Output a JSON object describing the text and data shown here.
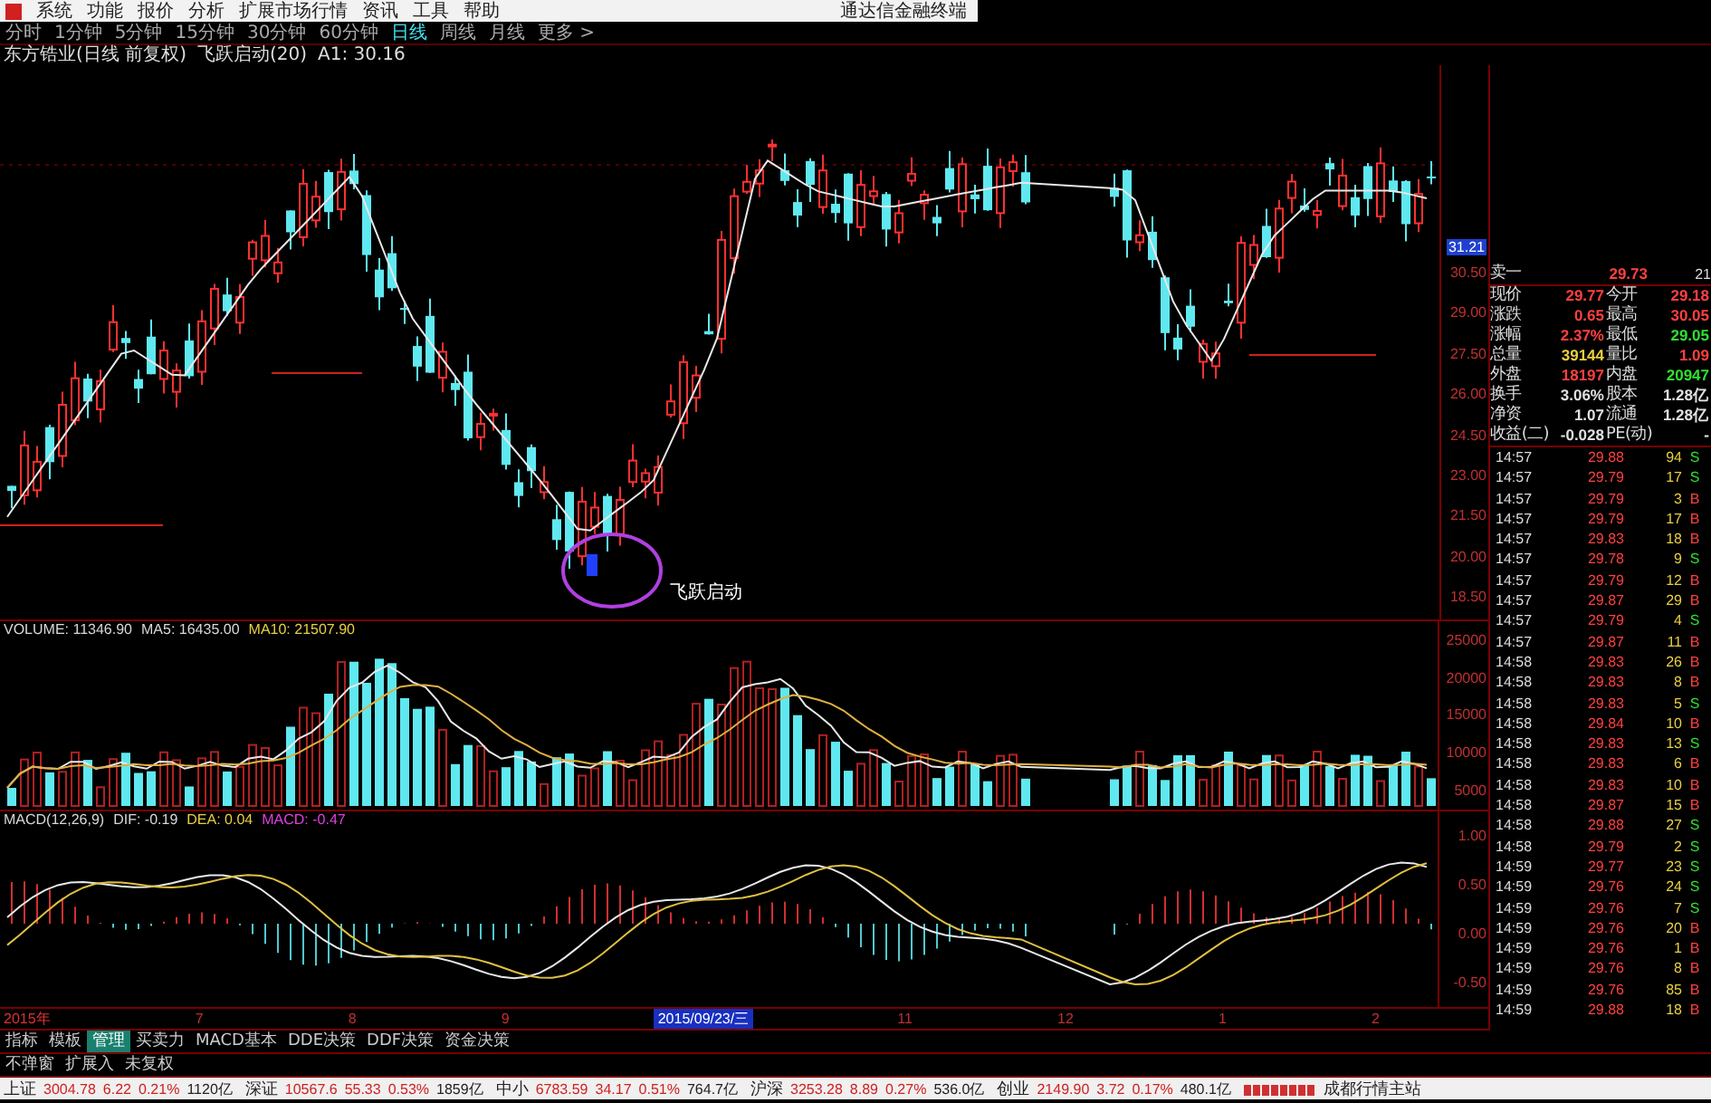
{
  "menu": {
    "items": [
      "系统",
      "功能",
      "报价",
      "分析",
      "扩展市场行情",
      "资讯",
      "工具",
      "帮助"
    ],
    "app_title": "通达信金融终端"
  },
  "periods": [
    {
      "label": "分时",
      "selected": false
    },
    {
      "label": "1分钟",
      "selected": false
    },
    {
      "label": "5分钟",
      "selected": false
    },
    {
      "label": "15分钟",
      "selected": false
    },
    {
      "label": "30分钟",
      "selected": false
    },
    {
      "label": "60分钟",
      "selected": false
    },
    {
      "label": "日线",
      "selected": true
    },
    {
      "label": "周线",
      "selected": false
    },
    {
      "label": "月线",
      "selected": false
    },
    {
      "label": "更多 >",
      "selected": false
    }
  ],
  "main_chart": {
    "title": "东方锆业(日线 前复权)",
    "indicator": "飞跃启动(20)",
    "readout": "A1: 30.16",
    "annotation": "飞跃启动",
    "cursor_label": "31.21",
    "axis_labels": [
      "30.50",
      "29.00",
      "27.50",
      "26.00",
      "24.50",
      "23.00",
      "21.50",
      "20.00",
      "18.50"
    ]
  },
  "volume": {
    "readouts": [
      {
        "text": "VOLUME: 11346.90",
        "color": "#d8d8d8"
      },
      {
        "text": "MA5: 16435.00",
        "color": "#d8d8d8"
      },
      {
        "text": "MA10: 21507.90",
        "color": "#e8d040"
      }
    ],
    "axis_labels": [
      "25000",
      "20000",
      "15000",
      "10000",
      "5000"
    ]
  },
  "macd": {
    "readouts": [
      {
        "text": "MACD(12,26,9)",
        "color": "#d8d8d8"
      },
      {
        "text": "DIF: -0.19",
        "color": "#d8d8d8"
      },
      {
        "text": "DEA: 0.04",
        "color": "#e8d040"
      },
      {
        "text": "MACD: -0.47",
        "color": "#e040e0"
      }
    ],
    "axis_labels": [
      "1.00",
      "0.50",
      "0.00",
      "-0.50"
    ]
  },
  "date_axis": [
    {
      "label": "2015年",
      "kind": "year"
    },
    {
      "label": "7",
      "kind": "month"
    },
    {
      "label": "8",
      "kind": "month"
    },
    {
      "label": "9",
      "kind": "month"
    },
    {
      "label": "2015/09/23/三",
      "kind": "cursor"
    },
    {
      "label": "11",
      "kind": "month"
    },
    {
      "label": "12",
      "kind": "month"
    },
    {
      "label": "1",
      "kind": "month"
    },
    {
      "label": "2",
      "kind": "month"
    }
  ],
  "quote": {
    "header": {
      "label": "卖一",
      "price": "29.73",
      "volume": "21"
    },
    "fields": [
      {
        "label": "现价",
        "value": "29.77",
        "color": "#ff4040"
      },
      {
        "label": "今开",
        "value": "29.18",
        "color": "#ff4040"
      },
      {
        "label": "涨跌",
        "value": "0.65",
        "color": "#ff4040"
      },
      {
        "label": "最高",
        "value": "30.05",
        "color": "#ff4040"
      },
      {
        "label": "涨幅",
        "value": "2.37%",
        "color": "#ff4040"
      },
      {
        "label": "最低",
        "value": "29.05",
        "color": "#30e030"
      },
      {
        "label": "总量",
        "value": "39144",
        "color": "#e8d040"
      },
      {
        "label": "量比",
        "value": "1.09",
        "color": "#ff4040"
      },
      {
        "label": "外盘",
        "value": "18197",
        "color": "#ff4040"
      },
      {
        "label": "内盘",
        "value": "20947",
        "color": "#30e030"
      },
      {
        "label": "换手",
        "value": "3.06%",
        "color": "#e0e0e0"
      },
      {
        "label": "股本",
        "value": "1.28亿",
        "color": "#e0e0e0"
      },
      {
        "label": "净资",
        "value": "1.07",
        "color": "#e0e0e0"
      },
      {
        "label": "流通",
        "value": "1.28亿",
        "color": "#e0e0e0"
      },
      {
        "label": "收益(二)",
        "value": "-0.028",
        "color": "#e0e0e0"
      },
      {
        "label": "PE(动)",
        "value": "-",
        "color": "#e0e0e0"
      }
    ],
    "ticks": [
      {
        "time": "14:57",
        "price": "29.88",
        "volume": "94",
        "side": "S",
        "color": "#30e030"
      },
      {
        "time": "14:57",
        "price": "29.79",
        "volume": "17",
        "side": "S",
        "color": "#30e030"
      },
      {
        "time": "14:57",
        "price": "29.79",
        "volume": "3",
        "side": "B",
        "color": "#ff4040"
      },
      {
        "time": "14:57",
        "price": "29.79",
        "volume": "17",
        "side": "B",
        "color": "#ff4040"
      },
      {
        "time": "14:57",
        "price": "29.83",
        "volume": "18",
        "side": "B",
        "color": "#ff4040"
      },
      {
        "time": "14:57",
        "price": "29.78",
        "volume": "9",
        "side": "S",
        "color": "#30e030"
      },
      {
        "time": "14:57",
        "price": "29.79",
        "volume": "12",
        "side": "B",
        "color": "#ff4040"
      },
      {
        "time": "14:57",
        "price": "29.87",
        "volume": "29",
        "side": "B",
        "color": "#ff4040"
      },
      {
        "time": "14:57",
        "price": "29.79",
        "volume": "4",
        "side": "S",
        "color": "#30e030"
      },
      {
        "time": "14:57",
        "price": "29.87",
        "volume": "11",
        "side": "B",
        "color": "#ff4040"
      },
      {
        "time": "14:58",
        "price": "29.83",
        "volume": "26",
        "side": "B",
        "color": "#ff4040"
      },
      {
        "time": "14:58",
        "price": "29.83",
        "volume": "8",
        "side": "B",
        "color": "#ff4040"
      },
      {
        "time": "14:58",
        "price": "29.83",
        "volume": "5",
        "side": "S",
        "color": "#30e030"
      },
      {
        "time": "14:58",
        "price": "29.84",
        "volume": "10",
        "side": "B",
        "color": "#ff4040"
      },
      {
        "time": "14:58",
        "price": "29.83",
        "volume": "13",
        "side": "S",
        "color": "#30e030"
      },
      {
        "time": "14:58",
        "price": "29.83",
        "volume": "6",
        "side": "B",
        "color": "#ff4040"
      },
      {
        "time": "14:58",
        "price": "29.83",
        "volume": "10",
        "side": "B",
        "color": "#ff4040"
      },
      {
        "time": "14:58",
        "price": "29.87",
        "volume": "15",
        "side": "B",
        "color": "#ff4040"
      },
      {
        "time": "14:58",
        "price": "29.88",
        "volume": "27",
        "side": "S",
        "color": "#30e030"
      },
      {
        "time": "14:58",
        "price": "29.79",
        "volume": "2",
        "side": "S",
        "color": "#30e030"
      },
      {
        "time": "14:59",
        "price": "29.77",
        "volume": "23",
        "side": "S",
        "color": "#30e030"
      },
      {
        "time": "14:59",
        "price": "29.76",
        "volume": "24",
        "side": "S",
        "color": "#30e030"
      },
      {
        "time": "14:59",
        "price": "29.76",
        "volume": "7",
        "side": "S",
        "color": "#30e030"
      },
      {
        "time": "14:59",
        "price": "29.76",
        "volume": "20",
        "side": "B",
        "color": "#ff4040"
      },
      {
        "time": "14:59",
        "price": "29.76",
        "volume": "1",
        "side": "B",
        "color": "#ff4040"
      },
      {
        "time": "14:59",
        "price": "29.76",
        "volume": "8",
        "side": "B",
        "color": "#ff4040"
      },
      {
        "time": "14:59",
        "price": "29.76",
        "volume": "85",
        "side": "B",
        "color": "#ff4040"
      },
      {
        "time": "14:59",
        "price": "29.88",
        "volume": "18",
        "side": "B",
        "color": "#ff4040"
      }
    ]
  },
  "indicator_tabs": [
    {
      "label": "指标",
      "selected": false
    },
    {
      "label": "模板",
      "selected": false
    },
    {
      "label": "管理",
      "selected": true
    },
    {
      "label": "买卖力",
      "selected": false
    },
    {
      "label": "MACD基本",
      "selected": false
    },
    {
      "label": "DDE决策",
      "selected": false
    },
    {
      "label": "DDF决策",
      "selected": false
    },
    {
      "label": "资金决策",
      "selected": false
    }
  ],
  "toolbar": [
    "不弹窗",
    "扩展入",
    "未复权"
  ],
  "status_bar": {
    "markets": [
      {
        "name": "上证",
        "index": "3004.78",
        "change": "6.22",
        "percent": "0.21%",
        "amount": "1120亿"
      },
      {
        "name": "深证",
        "index": "10567.6",
        "change": "55.33",
        "percent": "0.53%",
        "amount": "1859亿"
      },
      {
        "name": "中小",
        "index": "6783.59",
        "change": "34.17",
        "percent": "0.51%",
        "amount": "764.7亿"
      },
      {
        "name": "沪深",
        "index": "3253.28",
        "change": "8.89",
        "percent": "0.27%",
        "amount": "536.0亿"
      },
      {
        "name": "创业",
        "index": "2149.90",
        "change": "3.72",
        "percent": "0.17%",
        "amount": "480.1亿"
      }
    ],
    "server": "成都行情主站"
  }
}
